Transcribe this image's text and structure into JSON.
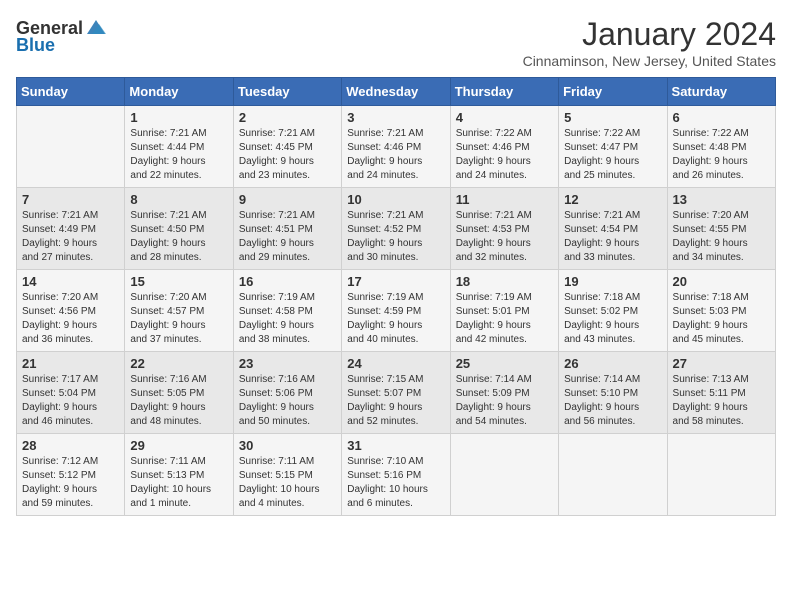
{
  "header": {
    "logo_general": "General",
    "logo_blue": "Blue",
    "month_title": "January 2024",
    "subtitle": "Cinnaminson, New Jersey, United States"
  },
  "days_of_week": [
    "Sunday",
    "Monday",
    "Tuesday",
    "Wednesday",
    "Thursday",
    "Friday",
    "Saturday"
  ],
  "weeks": [
    [
      {
        "day": "",
        "content": ""
      },
      {
        "day": "1",
        "content": "Sunrise: 7:21 AM\nSunset: 4:44 PM\nDaylight: 9 hours\nand 22 minutes."
      },
      {
        "day": "2",
        "content": "Sunrise: 7:21 AM\nSunset: 4:45 PM\nDaylight: 9 hours\nand 23 minutes."
      },
      {
        "day": "3",
        "content": "Sunrise: 7:21 AM\nSunset: 4:46 PM\nDaylight: 9 hours\nand 24 minutes."
      },
      {
        "day": "4",
        "content": "Sunrise: 7:22 AM\nSunset: 4:46 PM\nDaylight: 9 hours\nand 24 minutes."
      },
      {
        "day": "5",
        "content": "Sunrise: 7:22 AM\nSunset: 4:47 PM\nDaylight: 9 hours\nand 25 minutes."
      },
      {
        "day": "6",
        "content": "Sunrise: 7:22 AM\nSunset: 4:48 PM\nDaylight: 9 hours\nand 26 minutes."
      }
    ],
    [
      {
        "day": "7",
        "content": "Sunrise: 7:21 AM\nSunset: 4:49 PM\nDaylight: 9 hours\nand 27 minutes."
      },
      {
        "day": "8",
        "content": "Sunrise: 7:21 AM\nSunset: 4:50 PM\nDaylight: 9 hours\nand 28 minutes."
      },
      {
        "day": "9",
        "content": "Sunrise: 7:21 AM\nSunset: 4:51 PM\nDaylight: 9 hours\nand 29 minutes."
      },
      {
        "day": "10",
        "content": "Sunrise: 7:21 AM\nSunset: 4:52 PM\nDaylight: 9 hours\nand 30 minutes."
      },
      {
        "day": "11",
        "content": "Sunrise: 7:21 AM\nSunset: 4:53 PM\nDaylight: 9 hours\nand 32 minutes."
      },
      {
        "day": "12",
        "content": "Sunrise: 7:21 AM\nSunset: 4:54 PM\nDaylight: 9 hours\nand 33 minutes."
      },
      {
        "day": "13",
        "content": "Sunrise: 7:20 AM\nSunset: 4:55 PM\nDaylight: 9 hours\nand 34 minutes."
      }
    ],
    [
      {
        "day": "14",
        "content": "Sunrise: 7:20 AM\nSunset: 4:56 PM\nDaylight: 9 hours\nand 36 minutes."
      },
      {
        "day": "15",
        "content": "Sunrise: 7:20 AM\nSunset: 4:57 PM\nDaylight: 9 hours\nand 37 minutes."
      },
      {
        "day": "16",
        "content": "Sunrise: 7:19 AM\nSunset: 4:58 PM\nDaylight: 9 hours\nand 38 minutes."
      },
      {
        "day": "17",
        "content": "Sunrise: 7:19 AM\nSunset: 4:59 PM\nDaylight: 9 hours\nand 40 minutes."
      },
      {
        "day": "18",
        "content": "Sunrise: 7:19 AM\nSunset: 5:01 PM\nDaylight: 9 hours\nand 42 minutes."
      },
      {
        "day": "19",
        "content": "Sunrise: 7:18 AM\nSunset: 5:02 PM\nDaylight: 9 hours\nand 43 minutes."
      },
      {
        "day": "20",
        "content": "Sunrise: 7:18 AM\nSunset: 5:03 PM\nDaylight: 9 hours\nand 45 minutes."
      }
    ],
    [
      {
        "day": "21",
        "content": "Sunrise: 7:17 AM\nSunset: 5:04 PM\nDaylight: 9 hours\nand 46 minutes."
      },
      {
        "day": "22",
        "content": "Sunrise: 7:16 AM\nSunset: 5:05 PM\nDaylight: 9 hours\nand 48 minutes."
      },
      {
        "day": "23",
        "content": "Sunrise: 7:16 AM\nSunset: 5:06 PM\nDaylight: 9 hours\nand 50 minutes."
      },
      {
        "day": "24",
        "content": "Sunrise: 7:15 AM\nSunset: 5:07 PM\nDaylight: 9 hours\nand 52 minutes."
      },
      {
        "day": "25",
        "content": "Sunrise: 7:14 AM\nSunset: 5:09 PM\nDaylight: 9 hours\nand 54 minutes."
      },
      {
        "day": "26",
        "content": "Sunrise: 7:14 AM\nSunset: 5:10 PM\nDaylight: 9 hours\nand 56 minutes."
      },
      {
        "day": "27",
        "content": "Sunrise: 7:13 AM\nSunset: 5:11 PM\nDaylight: 9 hours\nand 58 minutes."
      }
    ],
    [
      {
        "day": "28",
        "content": "Sunrise: 7:12 AM\nSunset: 5:12 PM\nDaylight: 9 hours\nand 59 minutes."
      },
      {
        "day": "29",
        "content": "Sunrise: 7:11 AM\nSunset: 5:13 PM\nDaylight: 10 hours\nand 1 minute."
      },
      {
        "day": "30",
        "content": "Sunrise: 7:11 AM\nSunset: 5:15 PM\nDaylight: 10 hours\nand 4 minutes."
      },
      {
        "day": "31",
        "content": "Sunrise: 7:10 AM\nSunset: 5:16 PM\nDaylight: 10 hours\nand 6 minutes."
      },
      {
        "day": "",
        "content": ""
      },
      {
        "day": "",
        "content": ""
      },
      {
        "day": "",
        "content": ""
      }
    ]
  ]
}
